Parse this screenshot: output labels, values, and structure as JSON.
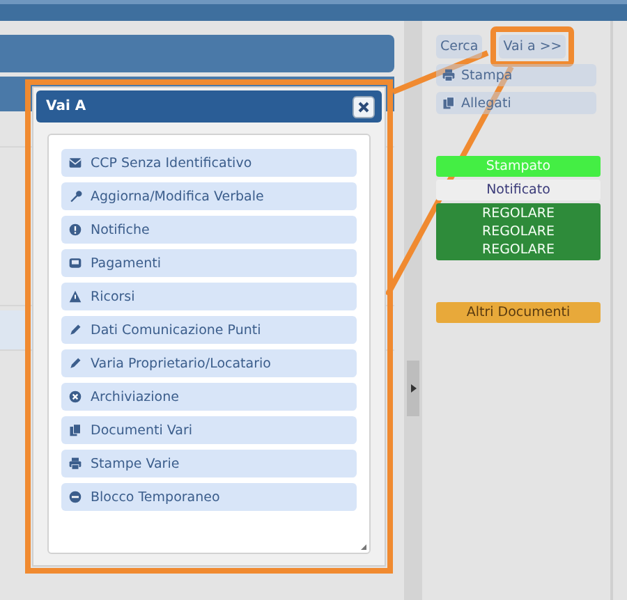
{
  "dialog": {
    "title": "Vai A",
    "highlighted": true,
    "items": [
      {
        "label": "CCP Senza Identificativo"
      },
      {
        "label": "Aggiorna/Modifica Verbale"
      },
      {
        "label": "Notifiche"
      },
      {
        "label": "Pagamenti"
      },
      {
        "label": "Ricorsi"
      },
      {
        "label": "Dati Comunicazione Punti"
      },
      {
        "label": "Varia Proprietario/Locatario"
      },
      {
        "label": "Archiviazione"
      },
      {
        "label": "Documenti Vari"
      },
      {
        "label": "Stampe Varie"
      },
      {
        "label": "Blocco Temporaneo"
      }
    ]
  },
  "side_panel": {
    "toolbar": [
      {
        "label": "Cerca",
        "highlighted": false
      },
      {
        "label": "Vai a >>",
        "highlighted": true
      }
    ],
    "actions": [
      {
        "label": "Stampa"
      },
      {
        "label": "Allegati"
      }
    ],
    "statuses": [
      {
        "lines": [
          "Stampato"
        ],
        "color": "#44ee44"
      },
      {
        "lines": [
          "Notificato"
        ],
        "color": "#eeeeee"
      },
      {
        "lines": [
          "REGOLARE",
          "REGOLARE",
          "REGOLARE"
        ],
        "color": "#2e8b3a"
      }
    ],
    "documents_button": {
      "label": "Altri Documenti",
      "color": "#e8a93a"
    }
  }
}
